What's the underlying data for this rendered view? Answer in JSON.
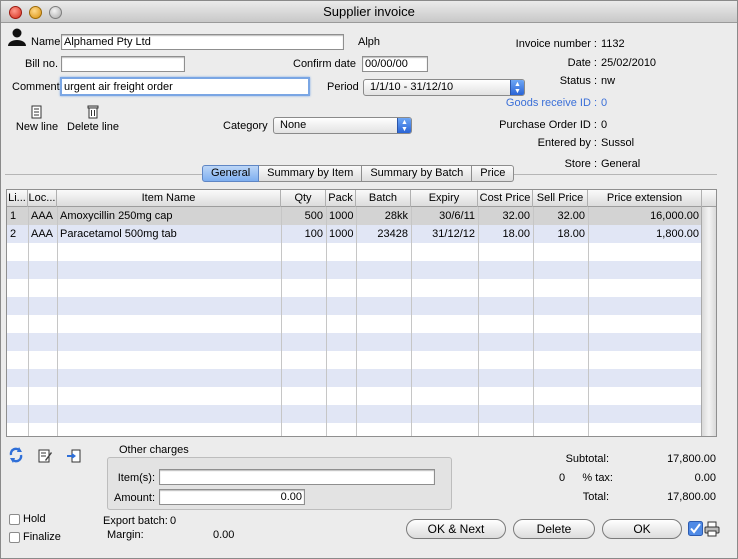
{
  "window": {
    "title": "Supplier invoice"
  },
  "header": {
    "name_label": "Name",
    "name_value": "Alphamed Pty Ltd",
    "name_code": "Alph",
    "billno_label": "Bill no.",
    "billno_value": "",
    "confirm_label": "Confirm date",
    "confirm_value": "00/00/00",
    "comment_label": "Comment",
    "comment_value": "urgent air freight order",
    "period_label": "Period",
    "period_value": "1/1/10 - 31/12/10",
    "category_label": "Category",
    "category_value": "None"
  },
  "info": {
    "invoice_number_label": "Invoice number :",
    "invoice_number": "1132",
    "date_label": "Date :",
    "date": "25/02/2010",
    "status_label": "Status :",
    "status": "nw",
    "goods_receive_label": "Goods receive ID :",
    "goods_receive_id": "0",
    "purchase_order_label": "Purchase Order ID :",
    "purchase_order_id": "0",
    "entered_by_label": "Entered by :",
    "entered_by": "Sussol",
    "store_label": "Store :",
    "store": "General"
  },
  "toolbar": {
    "new_line": "New line",
    "delete_line": "Delete line"
  },
  "tabs": [
    "General",
    "Summary by Item",
    "Summary by Batch",
    "Price"
  ],
  "table": {
    "headers": [
      "Li...",
      "Loc...",
      "Item Name",
      "Qty",
      "Pack",
      "Batch",
      "Expiry",
      "Cost Price",
      "Sell Price",
      "Price extension"
    ],
    "rows": [
      [
        "1",
        "AAA",
        "Amoxycillin 250mg cap",
        "500",
        "1000",
        "28kk",
        "30/6/11",
        "32.00",
        "32.00",
        "16,000.00"
      ],
      [
        "2",
        "AAA",
        "Paracetamol 500mg tab",
        "100",
        "1000",
        "23428",
        "31/12/12",
        "18.00",
        "18.00",
        "1,800.00"
      ]
    ]
  },
  "other_charges": {
    "title": "Other charges",
    "items_label": "Item(s):",
    "items_value": "",
    "amount_label": "Amount:",
    "amount_value": "0.00"
  },
  "totals": {
    "subtotal_label": "Subtotal:",
    "subtotal": "17,800.00",
    "tax_rate": "0",
    "tax_label": "% tax:",
    "tax": "0.00",
    "total_label": "Total:",
    "total": "17,800.00"
  },
  "footer": {
    "hold_label": "Hold",
    "finalize_label": "Finalize",
    "export_batch_label": "Export batch:",
    "export_batch": "0",
    "margin_label": "Margin:",
    "margin": "0.00",
    "ok_next": "OK & Next",
    "delete": "Delete",
    "ok": "OK"
  }
}
